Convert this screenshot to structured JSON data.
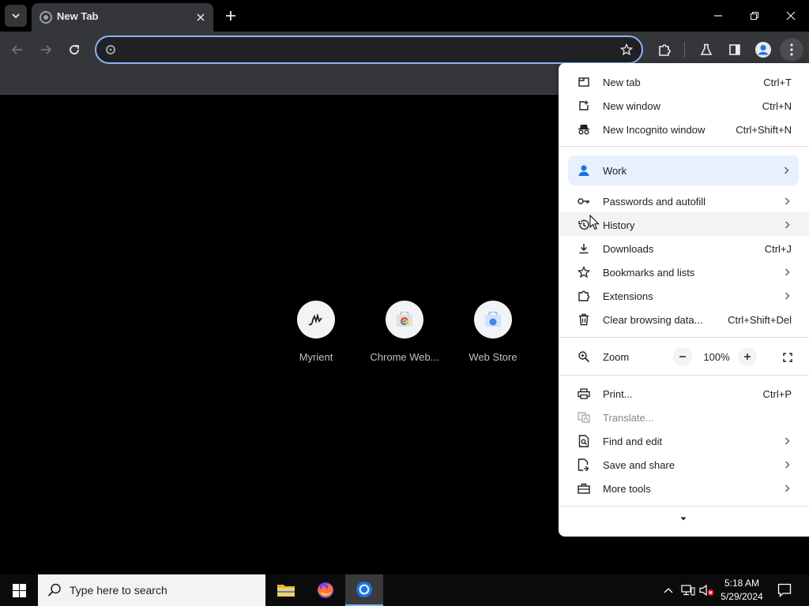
{
  "tab": {
    "title": "New Tab"
  },
  "omnibox": {
    "value": "",
    "placeholder": ""
  },
  "shortcuts": [
    {
      "label": "Myrient"
    },
    {
      "label": "Chrome Web..."
    },
    {
      "label": "Web Store"
    }
  ],
  "menu": {
    "new_tab": {
      "label": "New tab",
      "shortcut": "Ctrl+T"
    },
    "new_window": {
      "label": "New window",
      "shortcut": "Ctrl+N"
    },
    "new_incognito": {
      "label": "New Incognito window",
      "shortcut": "Ctrl+Shift+N"
    },
    "profile": {
      "label": "Work"
    },
    "passwords": {
      "label": "Passwords and autofill"
    },
    "history": {
      "label": "History"
    },
    "downloads": {
      "label": "Downloads",
      "shortcut": "Ctrl+J"
    },
    "bookmarks": {
      "label": "Bookmarks and lists"
    },
    "extensions": {
      "label": "Extensions"
    },
    "clear_data": {
      "label": "Clear browsing data...",
      "shortcut": "Ctrl+Shift+Del"
    },
    "zoom": {
      "label": "Zoom",
      "value": "100%"
    },
    "print": {
      "label": "Print...",
      "shortcut": "Ctrl+P"
    },
    "translate": {
      "label": "Translate..."
    },
    "find_edit": {
      "label": "Find and edit"
    },
    "save_share": {
      "label": "Save and share"
    },
    "more_tools": {
      "label": "More tools"
    }
  },
  "taskbar": {
    "search_text": "Type here to search",
    "time": "5:18 AM",
    "date": "5/29/2024"
  },
  "colors": {
    "accent": "#8ab4f8",
    "toolbar": "#35363a",
    "profile_highlight": "#e8f0fe"
  }
}
